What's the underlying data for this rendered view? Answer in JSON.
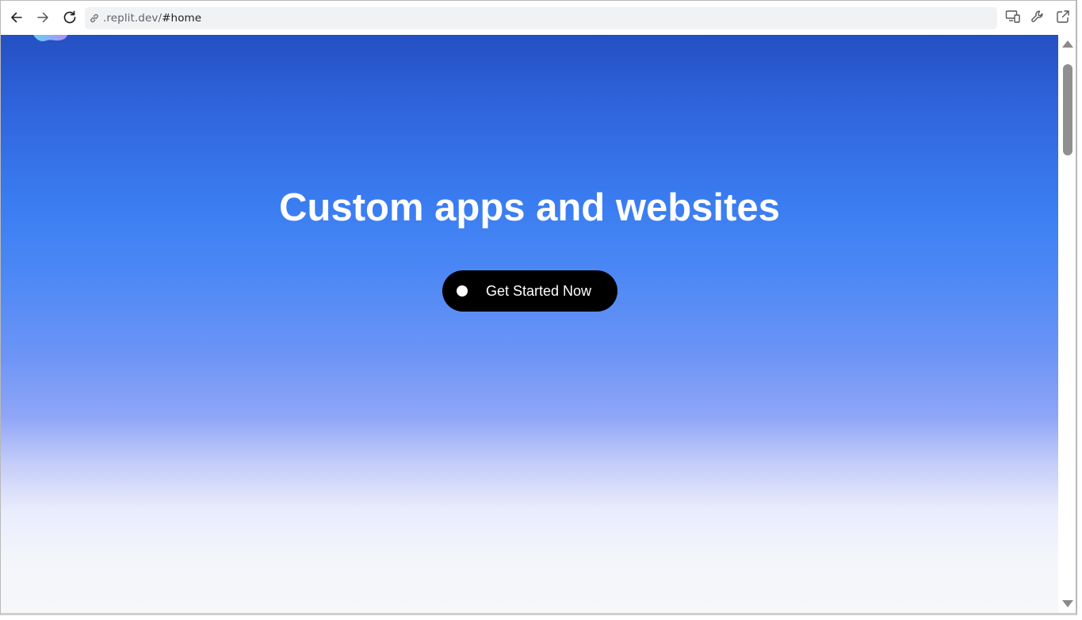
{
  "browser": {
    "url_domain": ".replit.dev/",
    "url_path": "#home",
    "icons": {
      "back": "arrow-left-icon",
      "forward": "arrow-right-icon",
      "reload": "reload-icon",
      "link": "link-icon",
      "devices": "responsive-devices-icon",
      "devtools": "wrench-icon",
      "open_new": "open-external-icon"
    }
  },
  "hero": {
    "title": "Custom apps and websites",
    "cta_label": "Get Started Now"
  },
  "colors": {
    "gradient_top": "#2450c2",
    "gradient_mid": "#3b7ef2",
    "gradient_bottom": "#f6f7f9",
    "cta_background": "#000000",
    "title_color": "#ffffff"
  }
}
